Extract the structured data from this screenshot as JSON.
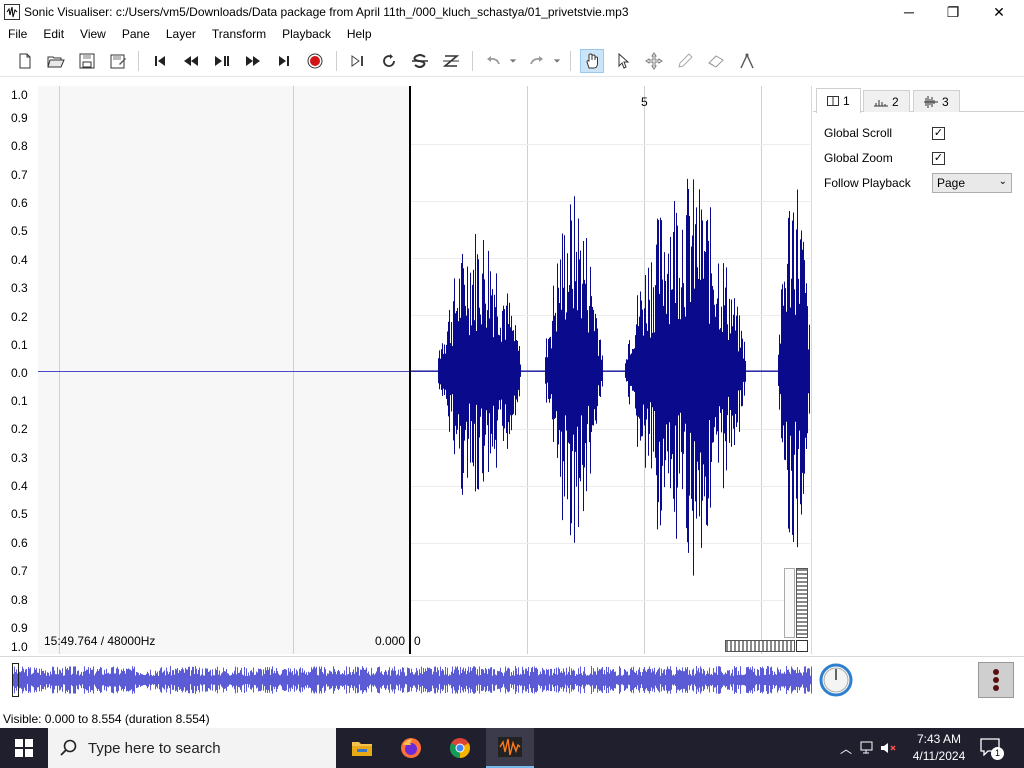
{
  "window": {
    "title": "Sonic Visualiser: c:/Users/vm5/Downloads/Data package from April 11th_/000_kluch_schastya/01_privetstvie.mp3",
    "minimize": "─",
    "maximize": "❐",
    "close": "✕"
  },
  "menu": [
    "File",
    "Edit",
    "View",
    "Pane",
    "Layer",
    "Transform",
    "Playback",
    "Help"
  ],
  "pane": {
    "scale_labels": [
      "1.0",
      "0.9",
      "0.8",
      "0.7",
      "0.6",
      "0.5",
      "0.4",
      "0.3",
      "0.2",
      "0.1",
      "0.0",
      "0.1",
      "0.2",
      "0.3",
      "0.4",
      "0.5",
      "0.6",
      "0.7",
      "0.8",
      "0.9",
      "1.0"
    ],
    "time_info": "15:49.764 / 48000Hz",
    "position_label": "0.000",
    "zero_tick": "0",
    "top_tick": "5"
  },
  "side": {
    "tabs": [
      {
        "label": "1",
        "icon": "pane-icon"
      },
      {
        "label": "2",
        "icon": "spectrum-icon"
      },
      {
        "label": "3",
        "icon": "waveform-icon"
      }
    ],
    "global_scroll_label": "Global Scroll",
    "global_scroll_checked": "✓",
    "global_zoom_label": "Global Zoom",
    "global_zoom_checked": "✓",
    "follow_playback_label": "Follow Playback",
    "follow_playback_value": "Page"
  },
  "status": {
    "visible": "Visible: 0.000 to 8.554 (duration 8.554)"
  },
  "taskbar": {
    "search_placeholder": "Type here to search",
    "time": "7:43 AM",
    "date": "4/11/2024",
    "notification_count": "1"
  },
  "colors": {
    "waveform": "#0a0a8c",
    "overview_wave": "#5b5bd6",
    "taskbar": "#1f1f2e",
    "accent": "#76b9ed"
  }
}
